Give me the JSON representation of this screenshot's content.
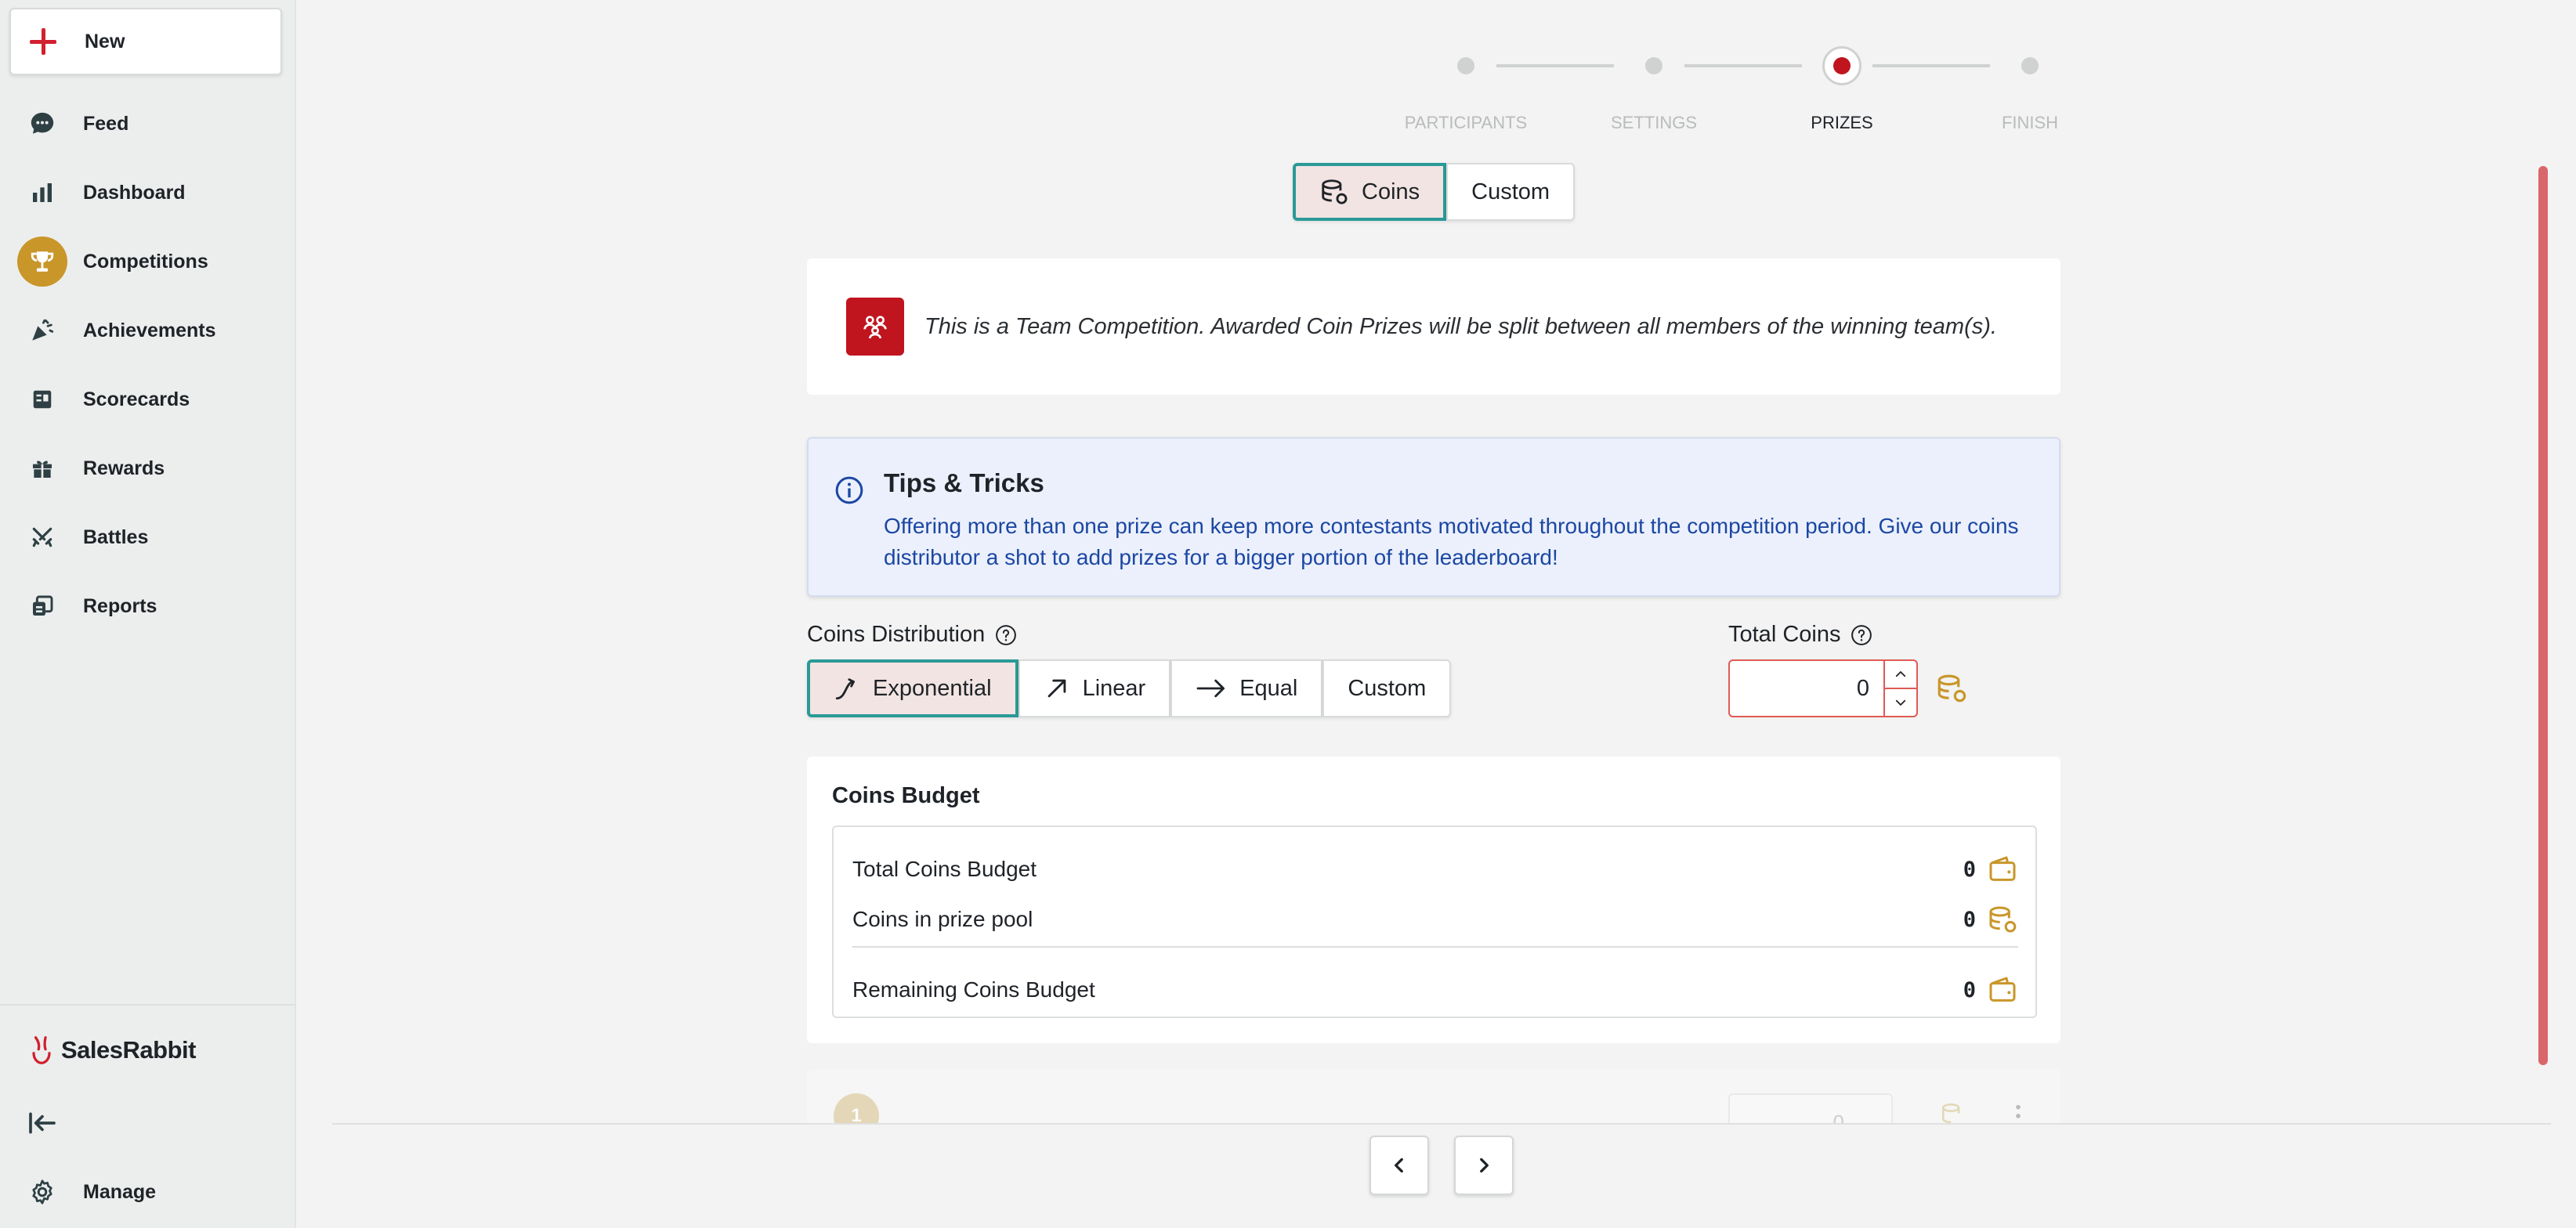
{
  "sidebar": {
    "new_label": "New",
    "items": [
      {
        "label": "Feed",
        "icon": "chat-bubble-icon"
      },
      {
        "label": "Dashboard",
        "icon": "bar-chart-icon"
      },
      {
        "label": "Competitions",
        "icon": "trophy-icon"
      },
      {
        "label": "Achievements",
        "icon": "party-popper-icon"
      },
      {
        "label": "Scorecards",
        "icon": "scorecard-icon"
      },
      {
        "label": "Rewards",
        "icon": "gift-icon"
      },
      {
        "label": "Battles",
        "icon": "crossed-swords-icon"
      },
      {
        "label": "Reports",
        "icon": "reports-icon"
      }
    ],
    "active_item": "Competitions",
    "brand": "SalesRabbit",
    "manage_label": "Manage"
  },
  "stepper": {
    "steps": [
      "PARTICIPANTS",
      "SETTINGS",
      "PRIZES",
      "FINISH"
    ],
    "current": "PRIZES"
  },
  "prize_type": {
    "options": [
      "Coins",
      "Custom"
    ],
    "selected": "Coins"
  },
  "team_notice": "This is a Team Competition. Awarded Coin Prizes will be split between all members of the winning team(s).",
  "tips": {
    "title": "Tips & Tricks",
    "body": "Offering more than one prize can keep more contestants motivated throughout the competition period. Give our coins distributor a shot to add prizes for a bigger portion of the leaderboard!"
  },
  "coins_distribution": {
    "label": "Coins Distribution",
    "options": [
      "Exponential",
      "Linear",
      "Equal",
      "Custom"
    ],
    "selected": "Exponential"
  },
  "total_coins": {
    "label": "Total Coins",
    "value": "0"
  },
  "budget": {
    "title": "Coins Budget",
    "rows": [
      {
        "name": "Total Coins Budget",
        "value": "0"
      },
      {
        "name": "Coins in prize pool",
        "value": "0"
      },
      {
        "name": "Remaining Coins Budget",
        "value": "0"
      }
    ]
  },
  "prize_row": {
    "rank": "1",
    "value": "0"
  },
  "colors": {
    "accent_teal": "#2a9a97",
    "brand_red": "#c0141e",
    "gold": "#c9962a",
    "tips_text_blue": "#1c47a3"
  }
}
